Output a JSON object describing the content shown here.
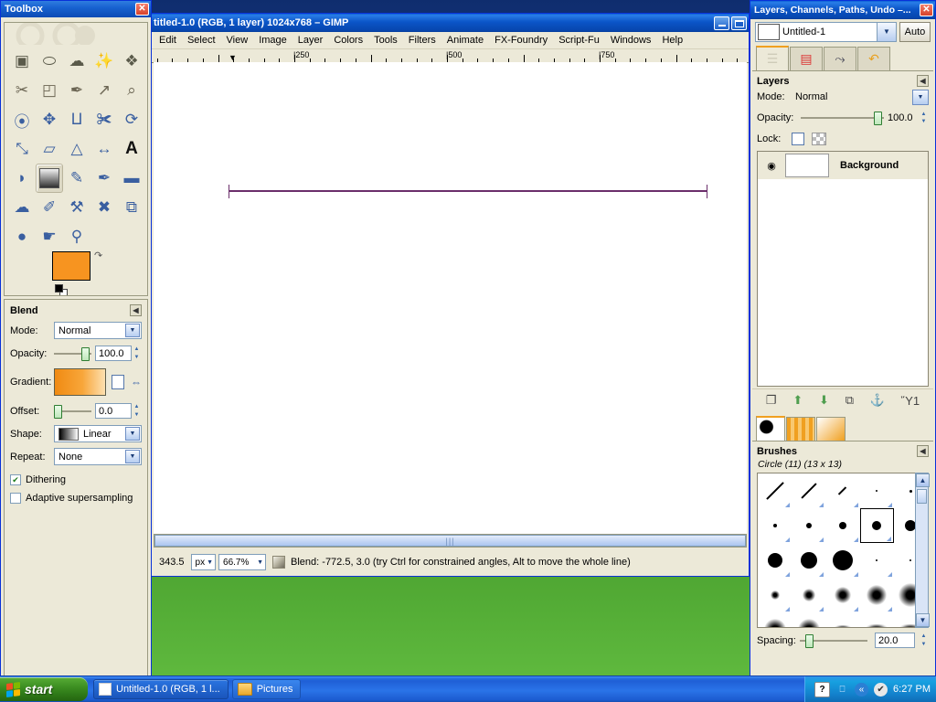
{
  "desktop": {
    "wallpaper_alt": "grass-field-wallpaper"
  },
  "toolbox": {
    "title": "Toolbox",
    "close_label": "✕",
    "tools": [
      {
        "name": "rect-select-icon",
        "glyph": "▣",
        "sel": false
      },
      {
        "name": "ellipse-select-icon",
        "glyph": "⬭",
        "sel": false
      },
      {
        "name": "free-select-icon",
        "glyph": "☁",
        "sel": false
      },
      {
        "name": "fuzzy-select-icon",
        "glyph": "✨",
        "sel": false
      },
      {
        "name": "select-by-color-icon",
        "glyph": "❖",
        "sel": false
      },
      {
        "name": "scissors-select-icon",
        "glyph": "✂",
        "sel": false
      },
      {
        "name": "foreground-select-icon",
        "glyph": "◰",
        "sel": false
      },
      {
        "name": "paths-icon",
        "glyph": "✒",
        "sel": false
      },
      {
        "name": "color-picker-icon",
        "glyph": "↗",
        "sel": false
      },
      {
        "name": "zoom-icon",
        "glyph": "⌕",
        "sel": false
      },
      {
        "name": "measure-icon",
        "glyph": "⦿",
        "sel": false
      },
      {
        "name": "move-icon",
        "glyph": "✥",
        "sel": false
      },
      {
        "name": "align-icon",
        "glyph": "⨿",
        "sel": false
      },
      {
        "name": "crop-icon",
        "glyph": "✀",
        "sel": false
      },
      {
        "name": "rotate-icon",
        "glyph": "⟳",
        "sel": false
      },
      {
        "name": "scale-icon",
        "glyph": "⤡",
        "sel": false
      },
      {
        "name": "shear-icon",
        "glyph": "▱",
        "sel": false
      },
      {
        "name": "perspective-icon",
        "glyph": "△",
        "sel": false
      },
      {
        "name": "flip-icon",
        "glyph": "↔",
        "sel": false
      },
      {
        "name": "text-icon",
        "glyph": "A",
        "sel": false
      },
      {
        "name": "bucket-fill-icon",
        "glyph": "◗",
        "sel": false
      },
      {
        "name": "blend-gradient-icon",
        "glyph": "▤",
        "sel": true
      },
      {
        "name": "pencil-icon",
        "glyph": "✎",
        "sel": false
      },
      {
        "name": "paintbrush-icon",
        "glyph": "✒",
        "sel": false
      },
      {
        "name": "eraser-icon",
        "glyph": "▬",
        "sel": false
      },
      {
        "name": "airbrush-icon",
        "glyph": "☁",
        "sel": false
      },
      {
        "name": "ink-icon",
        "glyph": "✐",
        "sel": false
      },
      {
        "name": "clone-icon",
        "glyph": "⚒",
        "sel": false
      },
      {
        "name": "heal-icon",
        "glyph": "✖",
        "sel": false
      },
      {
        "name": "perspective-clone-icon",
        "glyph": "⧉",
        "sel": false
      },
      {
        "name": "blur-sharpen-icon",
        "glyph": "●",
        "sel": false
      },
      {
        "name": "smudge-icon",
        "glyph": "☛",
        "sel": false
      },
      {
        "name": "dodge-burn-icon",
        "glyph": "⚲",
        "sel": false
      }
    ],
    "foreground_color": "#f79420",
    "background_color": "#ffffff"
  },
  "tool_options": {
    "title": "Blend",
    "collapse_glyph": "◀",
    "mode_label": "Mode:",
    "mode_value": "Normal",
    "opacity_label": "Opacity:",
    "opacity_value": "100.0",
    "gradient_label": "Gradient:",
    "offset_label": "Offset:",
    "offset_value": "0.0",
    "shape_label": "Shape:",
    "shape_value": "Linear",
    "repeat_label": "Repeat:",
    "repeat_value": "None",
    "dithering_label": "Dithering",
    "dithering_checked": "✔",
    "adaptive_label": "Adaptive supersampling"
  },
  "image_window": {
    "title": "titled-1.0 (RGB, 1 layer) 1024x768 – GIMP",
    "minimize_label": "_",
    "restore_label": "❐",
    "menu": [
      "Edit",
      "Select",
      "View",
      "Image",
      "Layer",
      "Colors",
      "Tools",
      "Filters",
      "Animate",
      "FX-Foundry",
      "Script-Fu",
      "Windows",
      "Help"
    ],
    "ruler_labels": [
      "250",
      "500",
      "750"
    ],
    "status": {
      "position": "343.5",
      "unit": "px",
      "zoom": "66.7%",
      "message": "Blend: -772.5, 3.0 (try Ctrl for constrained angles, Alt to move the whole line)"
    }
  },
  "dock": {
    "title": "Layers, Channels, Paths, Undo –...",
    "close_label": "✕",
    "image_name": "Untitled-1",
    "auto_label": "Auto",
    "tabs": [
      {
        "name": "tab-layers",
        "glyph": "☰",
        "active": true
      },
      {
        "name": "tab-channels",
        "glyph": "▤",
        "active": false
      },
      {
        "name": "tab-paths",
        "glyph": "⤳",
        "active": false
      },
      {
        "name": "tab-undo-history",
        "glyph": "↶",
        "active": false
      }
    ],
    "layers_panel": {
      "title": "Layers",
      "collapse_glyph": "◀",
      "mode_label": "Mode:",
      "mode_value": "Normal",
      "opacity_label": "Opacity:",
      "opacity_value": "100.0",
      "lock_label": "Lock:",
      "layers": [
        {
          "name": "Background",
          "visible": "◉"
        }
      ],
      "buttons": [
        {
          "name": "new-layer-button",
          "glyph": "❐"
        },
        {
          "name": "raise-layer-button",
          "glyph": "⬆"
        },
        {
          "name": "lower-layer-button",
          "glyph": "⬇"
        },
        {
          "name": "duplicate-layer-button",
          "glyph": "⧉"
        },
        {
          "name": "anchor-layer-button",
          "glyph": "⚓"
        },
        {
          "name": "delete-layer-button",
          "glyph": "Ὕ1"
        }
      ]
    },
    "brush_tabs": [
      {
        "name": "tab-brushes",
        "active": true
      },
      {
        "name": "tab-patterns",
        "active": false
      },
      {
        "name": "tab-gradients",
        "active": false
      }
    ],
    "brushes_panel": {
      "title": "Brushes",
      "collapse_glyph": "◀",
      "selected_brush": "Circle (11) (13 x 13)",
      "spacing_label": "Spacing:",
      "spacing_value": "20.0",
      "scroll_up": "▲",
      "scroll_down": "▼"
    }
  },
  "taskbar": {
    "start_label": "start",
    "items": [
      {
        "name": "taskitem-gimp",
        "label": "Untitled-1.0 (RGB, 1 l...",
        "active": true
      },
      {
        "name": "taskitem-pictures",
        "label": "Pictures",
        "active": false
      }
    ],
    "tray": {
      "help_glyph": "?",
      "show_hidden_glyph": "«",
      "icons": [
        "◔",
        "✔"
      ],
      "clock": "6:27 PM"
    }
  }
}
